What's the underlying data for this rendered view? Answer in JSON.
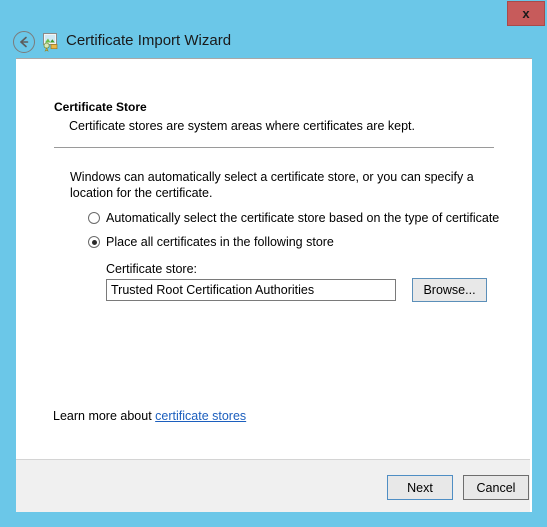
{
  "window": {
    "title": "Certificate Import Wizard",
    "close_label": "x",
    "back_icon": "back-arrow-icon",
    "wizard_icon": "certificate-wizard-icon",
    "titlebar_color": "#6BC7E8",
    "close_color": "#C75B5B"
  },
  "page": {
    "heading": "Certificate Store",
    "subheading": "Certificate stores are system areas where certificates are kept.",
    "intro": "Windows can automatically select a certificate store, or you can specify a location for the certificate."
  },
  "options": {
    "auto": {
      "label": "Automatically select the certificate store based on the type of certificate",
      "selected": false
    },
    "place": {
      "label": "Place all certificates in the following store",
      "selected": true
    }
  },
  "store": {
    "label": "Certificate store:",
    "value": "Trusted Root Certification Authorities",
    "placeholder": "",
    "browse_label": "Browse..."
  },
  "learn_more": {
    "prefix": "Learn more about ",
    "link_text": "certificate stores",
    "link_color": "#1c5fbe"
  },
  "footer": {
    "next_label": "Next",
    "cancel_label": "Cancel"
  }
}
